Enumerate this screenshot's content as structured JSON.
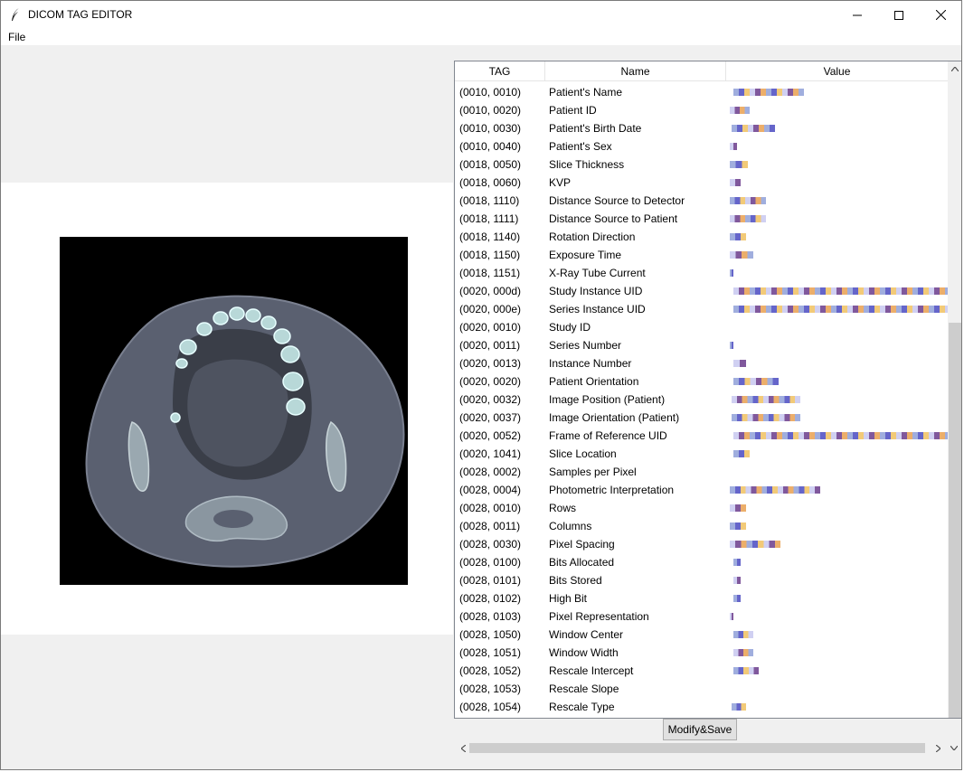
{
  "window": {
    "title": "DICOM TAG EDITOR",
    "icon": "feather-icon"
  },
  "menu": {
    "file": "File"
  },
  "table": {
    "headers": {
      "tag": "TAG",
      "name": "Name",
      "value": "Value"
    },
    "rows": [
      {
        "tag": "(0010, 0010)",
        "name": "Patient's Name"
      },
      {
        "tag": "(0010, 0020)",
        "name": "Patient ID"
      },
      {
        "tag": "(0010, 0030)",
        "name": "Patient's Birth Date"
      },
      {
        "tag": "(0010, 0040)",
        "name": "Patient's Sex"
      },
      {
        "tag": "(0018, 0050)",
        "name": "Slice Thickness"
      },
      {
        "tag": "(0018, 0060)",
        "name": "KVP"
      },
      {
        "tag": "(0018, 1110)",
        "name": "Distance Source to Detector"
      },
      {
        "tag": "(0018, 1111)",
        "name": "Distance Source to Patient"
      },
      {
        "tag": "(0018, 1140)",
        "name": "Rotation Direction"
      },
      {
        "tag": "(0018, 1150)",
        "name": "Exposure Time"
      },
      {
        "tag": "(0018, 1151)",
        "name": "X-Ray Tube Current"
      },
      {
        "tag": "(0020, 000d)",
        "name": "Study Instance UID"
      },
      {
        "tag": "(0020, 000e)",
        "name": "Series Instance UID"
      },
      {
        "tag": "(0020, 0010)",
        "name": "Study ID"
      },
      {
        "tag": "(0020, 0011)",
        "name": "Series Number"
      },
      {
        "tag": "(0020, 0013)",
        "name": "Instance Number"
      },
      {
        "tag": "(0020, 0020)",
        "name": "Patient Orientation"
      },
      {
        "tag": "(0020, 0032)",
        "name": "Image Position (Patient)"
      },
      {
        "tag": "(0020, 0037)",
        "name": "Image Orientation (Patient)"
      },
      {
        "tag": "(0020, 0052)",
        "name": "Frame of Reference UID"
      },
      {
        "tag": "(0020, 1041)",
        "name": "Slice Location"
      },
      {
        "tag": "(0028, 0002)",
        "name": "Samples per Pixel"
      },
      {
        "tag": "(0028, 0004)",
        "name": "Photometric Interpretation"
      },
      {
        "tag": "(0028, 0010)",
        "name": "Rows"
      },
      {
        "tag": "(0028, 0011)",
        "name": "Columns"
      },
      {
        "tag": "(0028, 0030)",
        "name": "Pixel Spacing"
      },
      {
        "tag": "(0028, 0100)",
        "name": "Bits Allocated"
      },
      {
        "tag": "(0028, 0101)",
        "name": "Bits Stored"
      },
      {
        "tag": "(0028, 0102)",
        "name": "High Bit"
      },
      {
        "tag": "(0028, 0103)",
        "name": "Pixel Representation"
      },
      {
        "tag": "(0028, 1050)",
        "name": "Window Center"
      },
      {
        "tag": "(0028, 1051)",
        "name": "Window Width"
      },
      {
        "tag": "(0028, 1052)",
        "name": "Rescale Intercept"
      },
      {
        "tag": "(0028, 1053)",
        "name": "Rescale Slope"
      },
      {
        "tag": "(0028, 1054)",
        "name": "Rescale Type"
      }
    ]
  },
  "buttons": {
    "modify_save": "Modify&Save"
  },
  "colors": {
    "redaction": [
      "#8fa0d8",
      "#e8a050",
      "#6a3a8a",
      "#c8c8f0",
      "#f0c060",
      "#4a4ac0"
    ]
  }
}
